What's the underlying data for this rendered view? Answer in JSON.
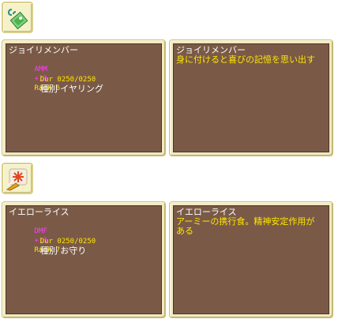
{
  "items": [
    {
      "icon": "earring-icon",
      "name": "ジョイリメンバー",
      "stat_tag": "AMM",
      "stat_value": "+13",
      "rank": "Rank 6",
      "dur": "Dur 0250/0250",
      "type": "種別 イヤリング",
      "desc_title": "ジョイリメンバー",
      "desc_lines": [
        "身に付けると喜びの記憶を思い出す"
      ],
      "stat_color": "#ff3cff",
      "rank_color": "#ffe600"
    },
    {
      "icon": "amulet-icon",
      "name": "イエローライス",
      "stat_tag": "DMF",
      "stat_value": "+13",
      "rank": "Rank 7",
      "dur": "Dur 0250/0250",
      "type": "種別 お守り",
      "desc_title": "イエローライス",
      "desc_lines": [
        "アーミーの携行食。精神安定作用が",
        "ある"
      ],
      "stat_color": "#ff3cff",
      "rank_color": "#ffe600"
    }
  ]
}
